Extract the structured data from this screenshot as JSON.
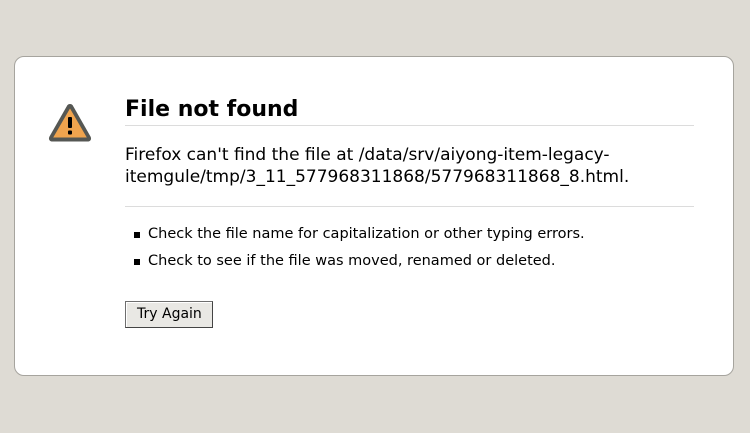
{
  "page": {
    "background": "#dedbd4",
    "icon": "warning-triangle-icon",
    "icon_color": "#f0a44e"
  },
  "error": {
    "title": "File not found",
    "message": "Firefox can't find the file at /data/srv/aiyong-item-legacy-itemgule/tmp/3_11_577968311868/577968311868_8.html.",
    "tips": [
      "Check the file name for capitalization or other typing errors.",
      "Check to see if the file was moved, renamed or deleted."
    ],
    "try_again_label": "Try Again"
  }
}
